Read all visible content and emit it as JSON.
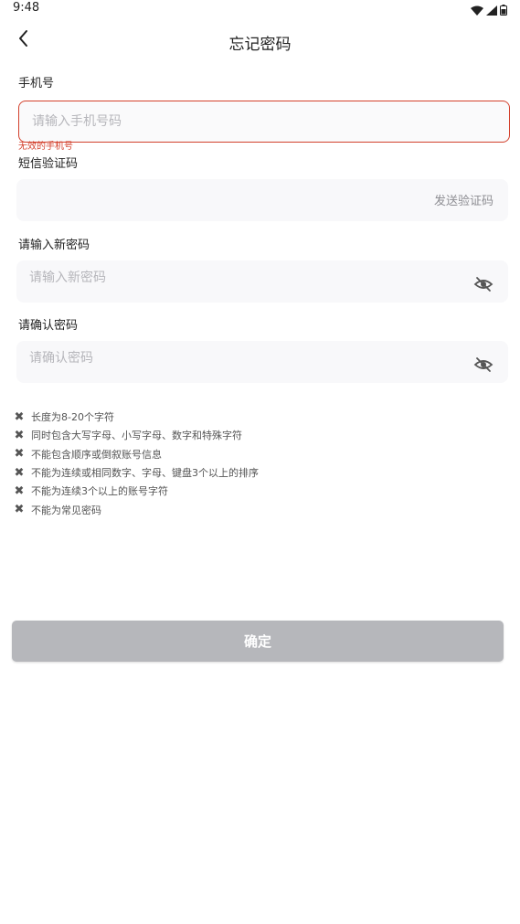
{
  "status_bar": {
    "time": "9:48"
  },
  "header": {
    "title": "忘记密码",
    "back_icon": "chevron-left-icon"
  },
  "form": {
    "phone": {
      "label": "手机号",
      "placeholder": "请输入手机号码",
      "value": "",
      "error": "无效的手机号"
    },
    "sms_code": {
      "label": "短信验证码",
      "placeholder": "",
      "value": "",
      "send_label": "发送验证码"
    },
    "new_password": {
      "label": "请输入新密码",
      "placeholder": "请输入新密码",
      "value": "",
      "toggle_icon": "eye-off-icon"
    },
    "confirm_password": {
      "label": "请确认密码",
      "placeholder": "请确认密码",
      "value": "",
      "toggle_icon": "eye-off-icon"
    }
  },
  "password_rules": [
    {
      "text": "长度为8-20个字符",
      "status": "fail"
    },
    {
      "text": "同时包含大写字母、小写字母、数字和特殊字符",
      "status": "fail"
    },
    {
      "text": "不能包含顺序或倒叙账号信息",
      "status": "fail"
    },
    {
      "text": "不能为连续或相同数字、字母、键盘3个以上的排序",
      "status": "fail"
    },
    {
      "text": "不能为连续3个以上的账号字符",
      "status": "fail"
    },
    {
      "text": "不能为常见密码",
      "status": "fail"
    }
  ],
  "submit": {
    "label": "确定"
  },
  "colors": {
    "error": "#d3402c",
    "button_disabled": "#b6b7bb",
    "field_bg": "#f8f8fa"
  }
}
